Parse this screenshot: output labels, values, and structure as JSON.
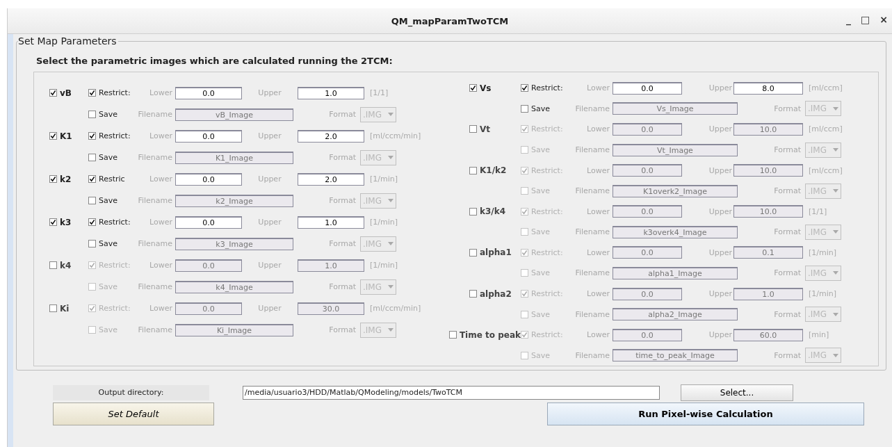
{
  "window": {
    "title": "QM_mapParamTwoTCM",
    "controls": [
      "_",
      "□",
      "×"
    ]
  },
  "panel": {
    "title": "Set Map Parameters",
    "heading": "Select the parametric images which are calculated running the 2TCM:"
  },
  "columns": [
    {
      "params": [
        {
          "name": "vB",
          "checked": true,
          "restrict_label": "Restrict:",
          "restrict": true,
          "lower_label": "Lower",
          "lower": "0.0",
          "upper_label": "Upper",
          "upper": "1.0",
          "unit": "[1/1]",
          "save_label": "Save",
          "save": false,
          "filename_label": "Filename",
          "filename": "vB_Image",
          "format_label": "Format",
          "format": ".IMG"
        },
        {
          "name": "K1",
          "checked": true,
          "restrict_label": "Restrict:",
          "restrict": true,
          "lower_label": "Lower",
          "lower": "0.0",
          "upper_label": "Upper",
          "upper": "2.0",
          "unit": "[ml/ccm/min]",
          "save_label": "Save",
          "save": false,
          "filename_label": "Filename",
          "filename": "K1_Image",
          "format_label": "Format",
          "format": ".IMG"
        },
        {
          "name": "k2",
          "checked": true,
          "restrict_label": "Restric",
          "restrict": true,
          "lower_label": "Lower",
          "lower": "0.0",
          "upper_label": "Upper",
          "upper": "2.0",
          "unit": "[1/min]",
          "save_label": "Save",
          "save": false,
          "filename_label": "Filename",
          "filename": "k2_Image",
          "format_label": "Format",
          "format": ".IMG"
        },
        {
          "name": "k3",
          "checked": true,
          "restrict_label": "Restrict:",
          "restrict": true,
          "lower_label": "Lower",
          "lower": "0.0",
          "upper_label": "Upper",
          "upper": "1.0",
          "unit": "[1/min]",
          "save_label": "Save",
          "save": false,
          "filename_label": "Filename",
          "filename": "k3_Image",
          "format_label": "Format",
          "format": ".IMG"
        },
        {
          "name": "k4",
          "checked": false,
          "restrict_label": "Restrict:",
          "restrict": true,
          "lower_label": "Lower",
          "lower": "0.0",
          "upper_label": "Upper",
          "upper": "1.0",
          "unit": "[1/min]",
          "save_label": "Save",
          "save": false,
          "filename_label": "Filename",
          "filename": "k4_Image",
          "format_label": "Format",
          "format": ".IMG"
        },
        {
          "name": "Ki",
          "checked": false,
          "restrict_label": "Restrict:",
          "restrict": true,
          "lower_label": "Lower",
          "lower": "0.0",
          "upper_label": "Upper",
          "upper": "30.0",
          "unit": "[ml/ccm/min]",
          "save_label": "Save",
          "save": false,
          "filename_label": "Filename",
          "filename": "Ki_Image",
          "format_label": "Format",
          "format": ".IMG"
        }
      ]
    },
    {
      "params": [
        {
          "name": "Vs",
          "checked": true,
          "restrict_label": "Restrict:",
          "restrict": true,
          "lower_label": "Lower",
          "lower": "0.0",
          "upper_label": "Upper",
          "upper": "8.0",
          "unit": "[ml/ccm]",
          "save_label": "Save",
          "save": false,
          "filename_label": "Filename",
          "filename": "Vs_Image",
          "format_label": "Format",
          "format": ".IMG"
        },
        {
          "name": "Vt",
          "checked": false,
          "restrict_label": "Restrict:",
          "restrict": true,
          "lower_label": "Lower",
          "lower": "0.0",
          "upper_label": "Upper",
          "upper": "10.0",
          "unit": "[ml/ccm]",
          "save_label": "Save",
          "save": false,
          "filename_label": "Filename",
          "filename": "Vt_Image",
          "format_label": "Format",
          "format": ".IMG"
        },
        {
          "name": "K1/k2",
          "checked": false,
          "restrict_label": "Restrict:",
          "restrict": true,
          "lower_label": "Lower",
          "lower": "0.0",
          "upper_label": "Upper",
          "upper": "10.0",
          "unit": "[ml/ccm]",
          "save_label": "Save",
          "save": false,
          "filename_label": "Filename",
          "filename": "K1overk2_Image",
          "format_label": "Format",
          "format": ".IMG"
        },
        {
          "name": "k3/k4",
          "checked": false,
          "restrict_label": "Restrict:",
          "restrict": true,
          "lower_label": "Lower",
          "lower": "0.0",
          "upper_label": "Upper",
          "upper": "10.0",
          "unit": "[1/1]",
          "save_label": "Save",
          "save": false,
          "filename_label": "Filename",
          "filename": "k3overk4_Image",
          "format_label": "Format",
          "format": ".IMG"
        },
        {
          "name": "alpha1",
          "checked": false,
          "restrict_label": "Restrict:",
          "restrict": true,
          "lower_label": "Lower",
          "lower": "0.0",
          "upper_label": "Upper",
          "upper": "0.1",
          "unit": "[1/min]",
          "save_label": "Save",
          "save": false,
          "filename_label": "Filename",
          "filename": "alpha1_Image",
          "format_label": "Format",
          "format": ".IMG"
        },
        {
          "name": "alpha2",
          "checked": false,
          "restrict_label": "Restrict:",
          "restrict": true,
          "lower_label": "Lower",
          "lower": "0.0",
          "upper_label": "Upper",
          "upper": "1.0",
          "unit": "[1/min]",
          "save_label": "Save",
          "save": false,
          "filename_label": "Filename",
          "filename": "alpha2_Image",
          "format_label": "Format",
          "format": ".IMG"
        },
        {
          "name": "Time to peak",
          "checked": false,
          "restrict_label": "Restrict:",
          "restrict": true,
          "lower_label": "Lower",
          "lower": "0.0",
          "upper_label": "Upper",
          "upper": "60.0",
          "unit": "[min]",
          "save_label": "Save",
          "save": false,
          "filename_label": "Filename",
          "filename": "time_to_peak_Image",
          "format_label": "Format",
          "format": ".IMG"
        }
      ]
    }
  ],
  "output": {
    "label": "Output directory:",
    "value": "/media/usuario3/HDD/Matlab/QModeling/models/TwoTCM",
    "select_button": "Select..."
  },
  "buttons": {
    "default": "Set Default",
    "run": "Run Pixel-wise Calculation"
  }
}
